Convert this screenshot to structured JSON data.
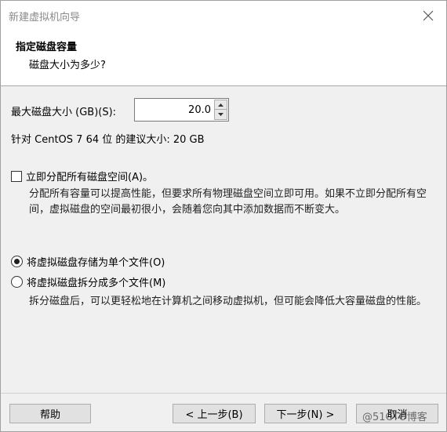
{
  "window": {
    "title": "新建虚拟机向导"
  },
  "header": {
    "title": "指定磁盘容量",
    "subtitle": "磁盘大小为多少?"
  },
  "disk_size": {
    "label": "最大磁盘大小 (GB)(S):",
    "value": "20.0"
  },
  "recommendation": "针对 CentOS 7 64 位 的建议大小: 20 GB",
  "allocate": {
    "label": "立即分配所有磁盘空间(A)。",
    "checked": false,
    "description": "分配所有容量可以提高性能，但要求所有物理磁盘空间立即可用。如果不立即分配所有空间，虚拟磁盘的空间最初很小，会随着您向其中添加数据而不断变大。"
  },
  "storage_options": [
    {
      "label": "将虚拟磁盘存储为单个文件(O)",
      "selected": true
    },
    {
      "label": "将虚拟磁盘拆分成多个文件(M)",
      "selected": false
    }
  ],
  "split_description": "拆分磁盘后，可以更轻松地在计算机之间移动虚拟机，但可能会降低大容量磁盘的性能。",
  "buttons": {
    "help": "帮助",
    "back": "< 上一步(B)",
    "next": "下一步(N) >",
    "cancel": "取消"
  },
  "watermark": "@51CTO博客"
}
